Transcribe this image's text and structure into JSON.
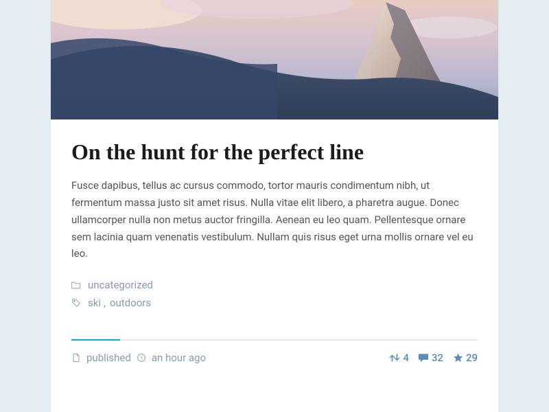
{
  "post": {
    "title": "On the hunt for the perfect line",
    "body": "Fusce dapibus, tellus ac cursus commodo, tortor mauris condimentum nibh, ut fermentum massa justo sit amet risus. Nulla vitae elit libero, a pharetra augue. Donec ullamcorper nulla non metus auctor fringilla. Aenean eu leo quam. Pellentesque ornare sem lacinia quam venenatis vestibulum. Nullam quis risus eget urna mollis ornare vel eu leo.",
    "category": "uncategorized",
    "tags": [
      "ski",
      "outdoors"
    ],
    "status": "published",
    "time_ago": "an hour ago",
    "stats": {
      "shares": "4",
      "comments": "32",
      "likes": "29"
    }
  }
}
